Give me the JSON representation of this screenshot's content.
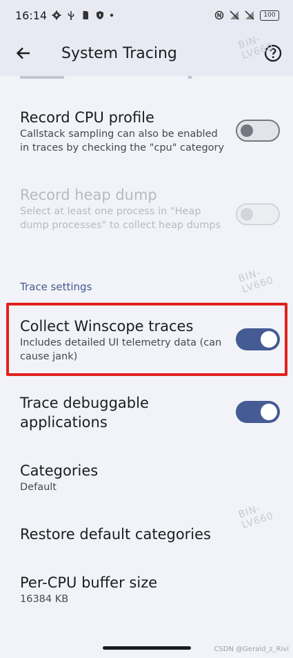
{
  "status_bar": {
    "time": "16:14",
    "battery": "100"
  },
  "app_bar": {
    "title": "System Tracing"
  },
  "watermark": "BIN-LV660",
  "preferences": {
    "record_cpu": {
      "title": "Record CPU profile",
      "summary": "Callstack sampling can also be enabled in traces by checking the \"cpu\" category",
      "enabled": false
    },
    "record_heap": {
      "title": "Record heap dump",
      "summary": "Select at least one process in \"Heap dump processes\" to collect heap dumps",
      "enabled": false,
      "disabled": true
    },
    "section_header": "Trace settings",
    "winscope": {
      "title": "Collect Winscope traces",
      "summary": "Includes detailed UI telemetry data (can cause jank)",
      "enabled": true
    },
    "debuggable": {
      "title": "Trace debuggable applications",
      "enabled": true
    },
    "categories": {
      "title": "Categories",
      "summary": "Default"
    },
    "restore": {
      "title": "Restore default categories"
    },
    "buffer": {
      "title": "Per-CPU buffer size",
      "summary": "16384 KB"
    }
  },
  "credit": "CSDN @Gerald_z_Rivi",
  "colors": {
    "accent": "#445b93",
    "highlight": "#e0201d"
  }
}
